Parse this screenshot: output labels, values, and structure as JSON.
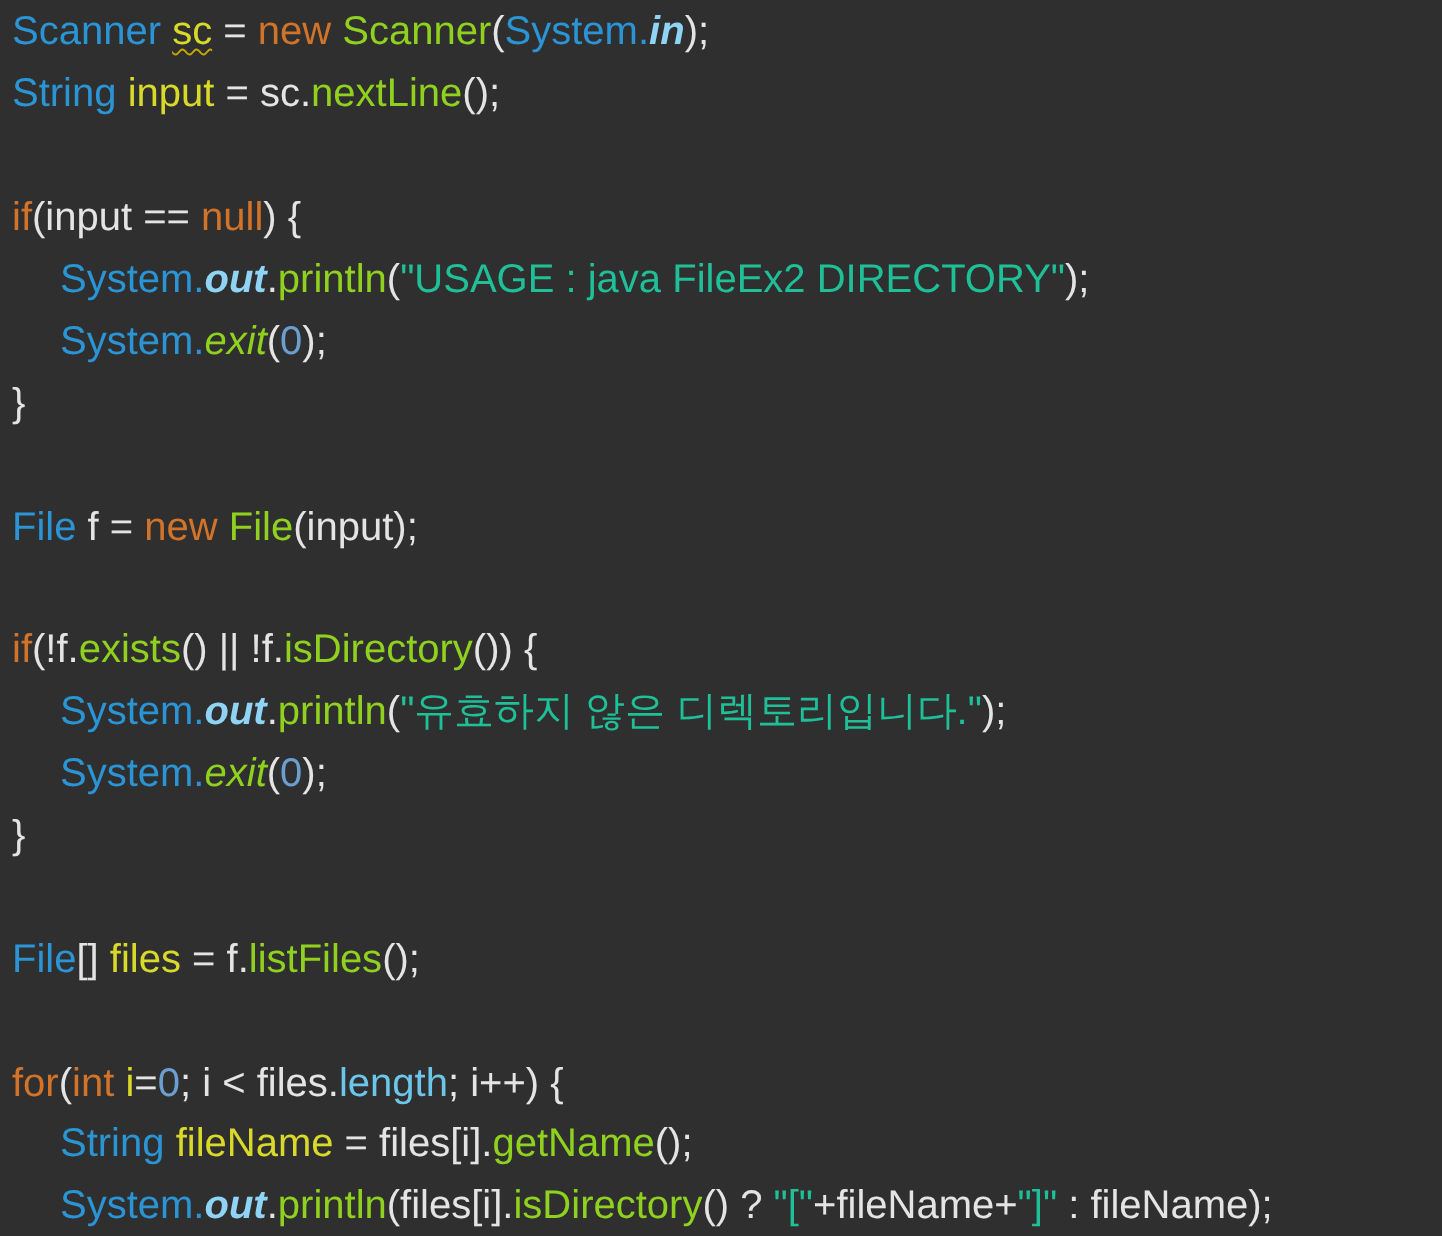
{
  "code_lines": [
    {
      "kind": "code",
      "indented": false,
      "tokens": [
        {
          "text": "Scanner ",
          "kind": "type"
        },
        {
          "text": "sc",
          "kind": "var",
          "warning": true
        },
        {
          "text": " = ",
          "kind": "plain"
        },
        {
          "text": "new ",
          "kind": "keyword"
        },
        {
          "text": "Scanner",
          "kind": "method"
        },
        {
          "text": "(",
          "kind": "plain"
        },
        {
          "text": "System.",
          "kind": "type"
        },
        {
          "text": "in",
          "kind": "field"
        },
        {
          "text": ");",
          "kind": "plain"
        }
      ]
    },
    {
      "kind": "code",
      "indented": false,
      "tokens": [
        {
          "text": "String ",
          "kind": "type"
        },
        {
          "text": "input",
          "kind": "var"
        },
        {
          "text": " = sc.",
          "kind": "plain"
        },
        {
          "text": "nextLine",
          "kind": "method"
        },
        {
          "text": "();",
          "kind": "plain"
        }
      ]
    },
    {
      "kind": "blank"
    },
    {
      "kind": "code",
      "indented": false,
      "tokens": [
        {
          "text": "if",
          "kind": "keyword"
        },
        {
          "text": "(input == ",
          "kind": "plain"
        },
        {
          "text": "null",
          "kind": "keyword"
        },
        {
          "text": ") {",
          "kind": "plain"
        }
      ]
    },
    {
      "kind": "code",
      "indented": true,
      "tokens": [
        {
          "text": "System.",
          "kind": "type"
        },
        {
          "text": "out",
          "kind": "field"
        },
        {
          "text": ".",
          "kind": "plain"
        },
        {
          "text": "println",
          "kind": "method"
        },
        {
          "text": "(",
          "kind": "plain"
        },
        {
          "text": "\"USAGE : java FileEx2 DIRECTORY\"",
          "kind": "string"
        },
        {
          "text": ");",
          "kind": "plain"
        }
      ]
    },
    {
      "kind": "code",
      "indented": true,
      "tokens": [
        {
          "text": "System.",
          "kind": "type"
        },
        {
          "text": "exit",
          "kind": "static_method"
        },
        {
          "text": "(",
          "kind": "plain"
        },
        {
          "text": "0",
          "kind": "number"
        },
        {
          "text": ");",
          "kind": "plain"
        }
      ]
    },
    {
      "kind": "code",
      "indented": false,
      "tokens": [
        {
          "text": "}",
          "kind": "plain"
        }
      ]
    },
    {
      "kind": "blank"
    },
    {
      "kind": "code",
      "indented": false,
      "tokens": [
        {
          "text": "File",
          "kind": "type"
        },
        {
          "text": " f = ",
          "kind": "plain"
        },
        {
          "text": "new ",
          "kind": "keyword"
        },
        {
          "text": "File",
          "kind": "method"
        },
        {
          "text": "(input);",
          "kind": "plain"
        }
      ]
    },
    {
      "kind": "blank"
    },
    {
      "kind": "code",
      "indented": false,
      "tokens": [
        {
          "text": "if",
          "kind": "keyword"
        },
        {
          "text": "(!f.",
          "kind": "plain"
        },
        {
          "text": "exists",
          "kind": "method"
        },
        {
          "text": "() || !f.",
          "kind": "plain"
        },
        {
          "text": "isDirectory",
          "kind": "method"
        },
        {
          "text": "()) {",
          "kind": "plain"
        }
      ]
    },
    {
      "kind": "code",
      "indented": true,
      "tokens": [
        {
          "text": "System.",
          "kind": "type"
        },
        {
          "text": "out",
          "kind": "field"
        },
        {
          "text": ".",
          "kind": "plain"
        },
        {
          "text": "println",
          "kind": "method"
        },
        {
          "text": "(",
          "kind": "plain"
        },
        {
          "text": "\"유효하지 않은 디렉토리입니다.\"",
          "kind": "string"
        },
        {
          "text": ");",
          "kind": "plain"
        }
      ]
    },
    {
      "kind": "code",
      "indented": true,
      "tokens": [
        {
          "text": "System.",
          "kind": "type"
        },
        {
          "text": "exit",
          "kind": "static_method"
        },
        {
          "text": "(",
          "kind": "plain"
        },
        {
          "text": "0",
          "kind": "number"
        },
        {
          "text": ");",
          "kind": "plain"
        }
      ]
    },
    {
      "kind": "code",
      "indented": false,
      "tokens": [
        {
          "text": "}",
          "kind": "plain"
        }
      ]
    },
    {
      "kind": "blank"
    },
    {
      "kind": "code",
      "indented": false,
      "tokens": [
        {
          "text": "File",
          "kind": "type"
        },
        {
          "text": "[] ",
          "kind": "plain"
        },
        {
          "text": "files",
          "kind": "var"
        },
        {
          "text": " = f.",
          "kind": "plain"
        },
        {
          "text": "listFiles",
          "kind": "method"
        },
        {
          "text": "();",
          "kind": "plain"
        }
      ]
    },
    {
      "kind": "blank"
    },
    {
      "kind": "code",
      "indented": false,
      "tokens": [
        {
          "text": "for",
          "kind": "keyword"
        },
        {
          "text": "(",
          "kind": "plain"
        },
        {
          "text": "int ",
          "kind": "keyword"
        },
        {
          "text": "i",
          "kind": "var"
        },
        {
          "text": "=",
          "kind": "plain"
        },
        {
          "text": "0",
          "kind": "number"
        },
        {
          "text": "; i < files.",
          "kind": "plain"
        },
        {
          "text": "length",
          "kind": "member"
        },
        {
          "text": "; i++) {",
          "kind": "plain"
        }
      ]
    },
    {
      "kind": "code",
      "indented": true,
      "tokens": [
        {
          "text": "String ",
          "kind": "type"
        },
        {
          "text": "fileName",
          "kind": "var"
        },
        {
          "text": " = files[i].",
          "kind": "plain"
        },
        {
          "text": "getName",
          "kind": "method"
        },
        {
          "text": "();",
          "kind": "plain"
        }
      ]
    },
    {
      "kind": "code",
      "indented": true,
      "tokens": [
        {
          "text": "System.",
          "kind": "type"
        },
        {
          "text": "out",
          "kind": "field"
        },
        {
          "text": ".",
          "kind": "plain"
        },
        {
          "text": "println",
          "kind": "method"
        },
        {
          "text": "(files[i].",
          "kind": "plain"
        },
        {
          "text": "isDirectory",
          "kind": "method"
        },
        {
          "text": "() ? ",
          "kind": "plain"
        },
        {
          "text": "\"[\"",
          "kind": "string"
        },
        {
          "text": "+fileName+",
          "kind": "plain"
        },
        {
          "text": "\"]\"",
          "kind": "string"
        },
        {
          "text": " : fileName);",
          "kind": "plain"
        }
      ]
    }
  ]
}
